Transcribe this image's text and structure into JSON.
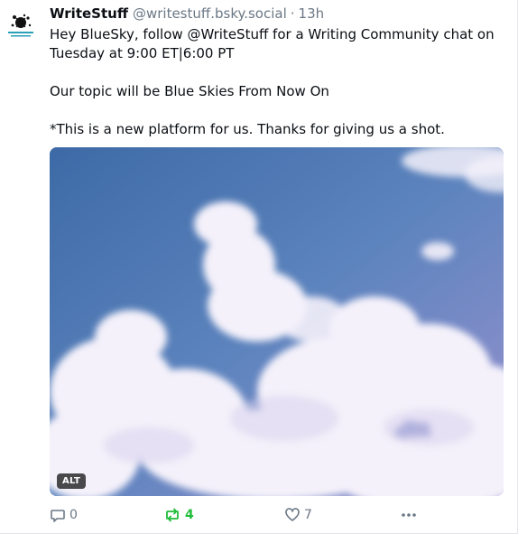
{
  "post": {
    "author_name": "WriteStuff",
    "author_handle": "@writestuff.bsky.social",
    "separator": "·",
    "time": "13h",
    "text_line1": "Hey BlueSky, follow @WriteStuff for a Writing Community chat on Tuesday at 9:00 ET|6:00 PT",
    "text_line2": "Our topic will be Blue Skies From Now On",
    "text_line3": "*This is a new platform for us. Thanks for giving us a shot.",
    "image_alt_badge": "ALT",
    "avatar_icon": "ink-splat-logo-icon",
    "image_subject": "clouds-photo"
  },
  "actions": {
    "reply_count": "0",
    "repost_count": "4",
    "like_count": "7",
    "reply_icon": "comment-icon",
    "repost_icon": "repost-icon",
    "like_icon": "heart-icon",
    "more_icon": "more-dots-icon"
  },
  "colors": {
    "name": "#0b0f14",
    "muted": "#6b7886",
    "repost_active": "#20bc3a",
    "sky": "#4a78b0"
  }
}
